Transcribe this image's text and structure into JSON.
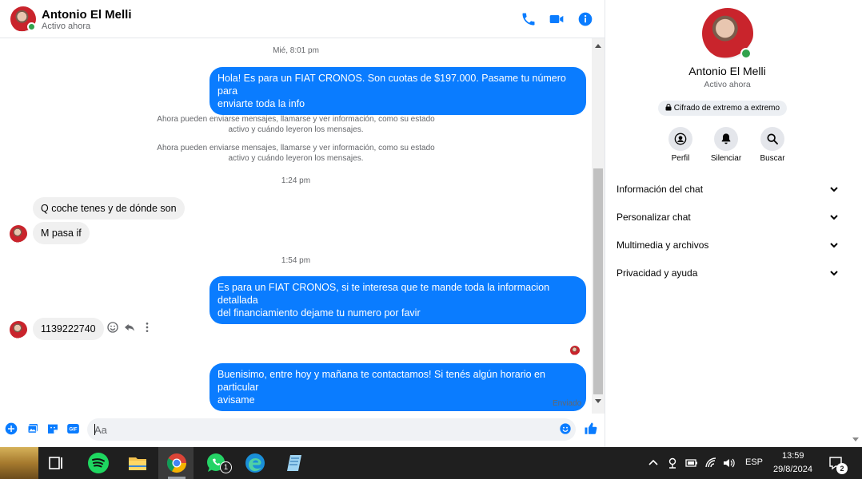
{
  "header": {
    "name": "Antonio El Melli",
    "status": "Activo ahora",
    "icons": [
      "phone-icon",
      "video-icon",
      "info-icon"
    ]
  },
  "messages": {
    "ts1": "Mié, 8:01 pm",
    "out1_line1": "Hola! Es para un FIAT CRONOS. Son cuotas de $197.000. Pasame tu número para",
    "out1_line2": "enviarte toda la info",
    "sys1_line1": "Ahora pueden enviarse mensajes, llamarse y ver información, como su estado",
    "sys1_line2": "activo y cuándo leyeron los mensajes.",
    "sys2_line1": "Ahora pueden enviarse mensajes, llamarse y ver información, como su estado",
    "sys2_line2": "activo y cuándo leyeron los mensajes.",
    "ts2": "1:24 pm",
    "in1": "Q coche tenes y de dónde son",
    "in2": "M pasa if",
    "ts3": "1:54 pm",
    "out2_line1": "Es para un FIAT CRONOS, si te interesa que te mande toda la informacion detallada",
    "out2_line2": "del financiamiento dejame tu numero por favir",
    "in3": "1139222740",
    "out3_line1": "Buenisimo, entre hoy y mañana te contactamos! Si tenés algún horario en particular",
    "out3_line2": "avisame",
    "sent_status": "Enviado"
  },
  "composer": {
    "placeholder": "Aa",
    "gif_label": "GIF"
  },
  "side": {
    "name": "Antonio El Melli",
    "status": "Activo ahora",
    "e2e": "Cifrado de extremo a extremo",
    "actions": [
      {
        "label": "Perfil",
        "icon": "profile-icon"
      },
      {
        "label": "Silenciar",
        "icon": "bell-icon"
      },
      {
        "label": "Buscar",
        "icon": "search-icon"
      }
    ],
    "sections": [
      {
        "label": "Información del chat"
      },
      {
        "label": "Personalizar chat"
      },
      {
        "label": "Multimedia y archivos"
      },
      {
        "label": "Privacidad y ayuda"
      }
    ]
  },
  "taskbar": {
    "whatsapp_badge": "1",
    "lang": "ESP",
    "time": "13:59",
    "date": "29/8/2024",
    "notif_count": "2"
  },
  "colors": {
    "accent": "#0a7cff",
    "online": "#31a24c",
    "taskbar": "#1f1f1f"
  }
}
